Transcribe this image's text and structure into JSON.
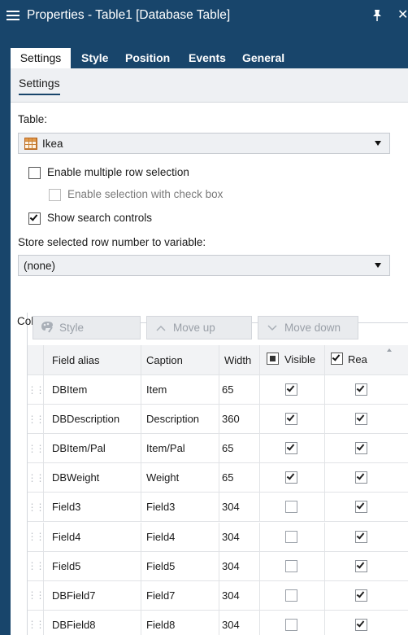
{
  "window": {
    "title": "Properties - Table1 [Database Table]",
    "menu_icon": "hamburger-menu-icon",
    "pin_icon": "pin-icon",
    "close_glyph": "✕"
  },
  "tabs": [
    "Settings",
    "Style",
    "Position",
    "Events",
    "General"
  ],
  "active_tab": "Settings",
  "subtabs": [
    "Settings"
  ],
  "settings": {
    "table_label": "Table:",
    "table_value": "Ikea",
    "table_icon": "table-icon",
    "enable_multi_label": "Enable multiple row selection",
    "enable_multi_checked": false,
    "enable_checkbox_label": "Enable selection with check box",
    "enable_checkbox_checked": false,
    "enable_checkbox_disabled": true,
    "show_search_label": "Show search controls",
    "show_search_checked": true,
    "store_label": "Store selected row number to variable:",
    "store_value": "(none)"
  },
  "columns": {
    "group_label": "Columns",
    "buttons": {
      "style": "Style",
      "move_up": "Move up",
      "move_down": "Move down"
    },
    "headers": {
      "field_alias": "Field alias",
      "caption": "Caption",
      "width": "Width",
      "visible": "Visible",
      "readonly": "Rea"
    },
    "header_visible_state": "indeterminate",
    "header_readonly_state": "checked",
    "rows": [
      {
        "alias": "DBItem",
        "caption": "Item",
        "width": "65",
        "visible": true,
        "readonly": true
      },
      {
        "alias": "DBDescription",
        "caption": "Description",
        "width": "360",
        "visible": true,
        "readonly": true
      },
      {
        "alias": "DBItem/Pal",
        "caption": "Item/Pal",
        "width": "65",
        "visible": true,
        "readonly": true
      },
      {
        "alias": "DBWeight",
        "caption": "Weight",
        "width": "65",
        "visible": true,
        "readonly": true
      },
      {
        "alias": "Field3",
        "caption": "Field3",
        "width": "304",
        "visible": false,
        "readonly": true
      },
      {
        "alias": "Field4",
        "caption": "Field4",
        "width": "304",
        "visible": false,
        "readonly": true
      },
      {
        "alias": "Field5",
        "caption": "Field5",
        "width": "304",
        "visible": false,
        "readonly": true
      },
      {
        "alias": "DBField7",
        "caption": "Field7",
        "width": "304",
        "visible": false,
        "readonly": true
      },
      {
        "alias": "DBField8",
        "caption": "Field8",
        "width": "304",
        "visible": false,
        "readonly": true
      }
    ]
  },
  "colors": {
    "titlebar": "#18456b",
    "panel_bg": "#ffffff",
    "subtab_bg": "#eef0f3"
  }
}
